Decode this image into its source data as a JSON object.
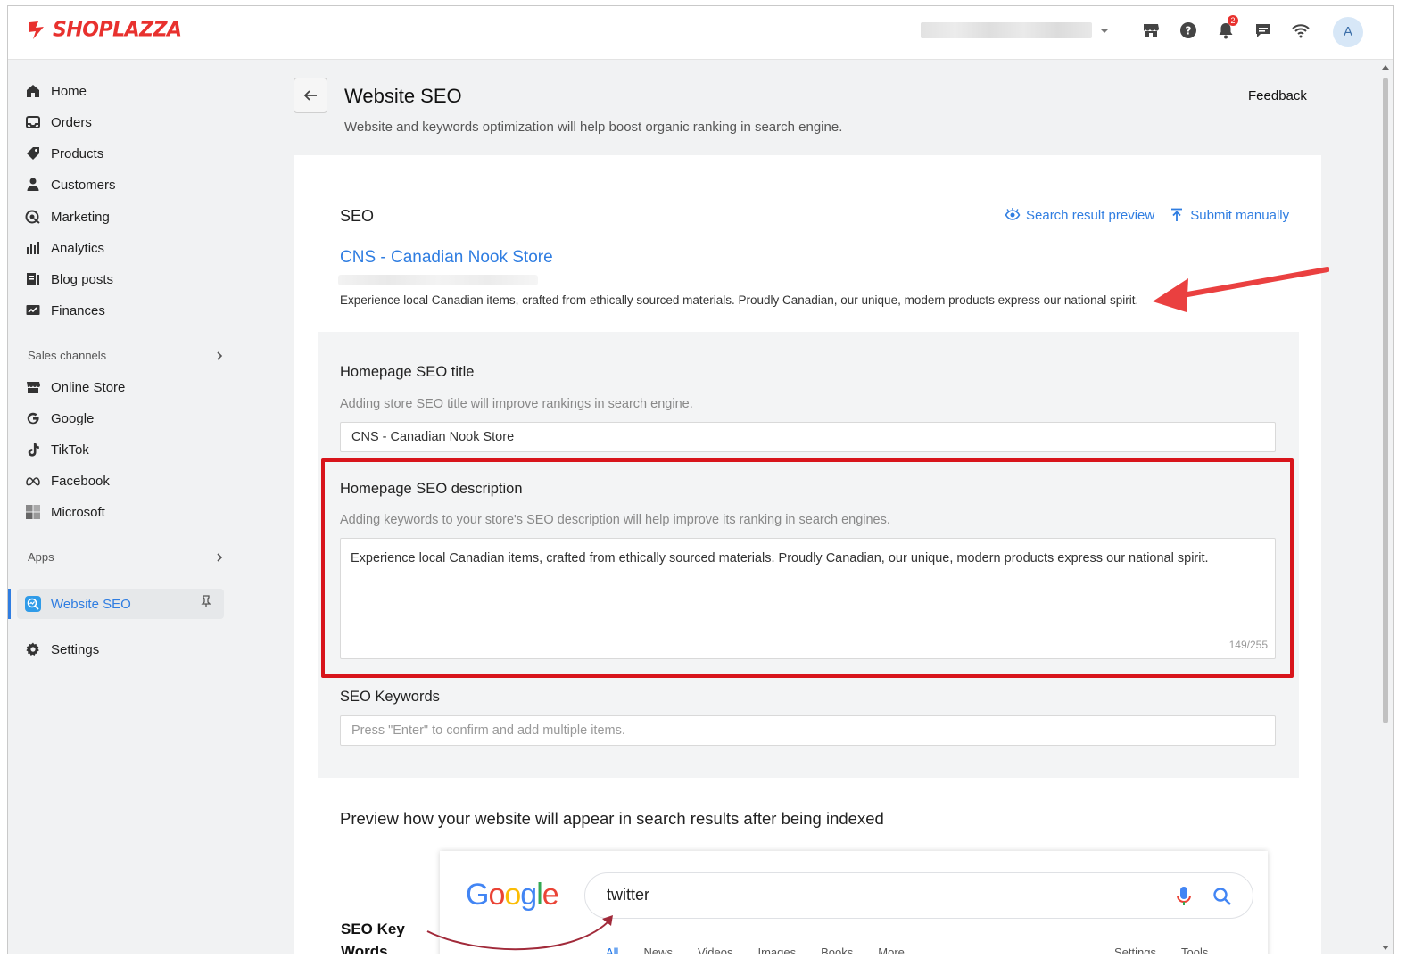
{
  "brand": {
    "name": "SHOPLAZZA",
    "color": "#e8312e"
  },
  "topbar": {
    "icons": [
      "storefront-icon",
      "help-icon",
      "bell-icon",
      "chat-icon",
      "wifi-icon"
    ],
    "notification_count": "2",
    "avatar_initial": "A"
  },
  "sidebar": {
    "items": [
      {
        "label": "Home",
        "icon": "home-icon"
      },
      {
        "label": "Orders",
        "icon": "orders-icon"
      },
      {
        "label": "Products",
        "icon": "tag-icon"
      },
      {
        "label": "Customers",
        "icon": "person-icon"
      },
      {
        "label": "Marketing",
        "icon": "target-icon"
      },
      {
        "label": "Analytics",
        "icon": "bar-chart-icon"
      },
      {
        "label": "Blog posts",
        "icon": "blog-icon"
      },
      {
        "label": "Finances",
        "icon": "finance-icon"
      }
    ],
    "sales_channels_header": "Sales channels",
    "channels": [
      {
        "label": "Online Store",
        "icon": "store-icon"
      },
      {
        "label": "Google",
        "icon": "google-icon"
      },
      {
        "label": "TikTok",
        "icon": "tiktok-icon"
      },
      {
        "label": "Facebook",
        "icon": "meta-icon"
      },
      {
        "label": "Microsoft",
        "icon": "microsoft-icon"
      }
    ],
    "apps_header": "Apps",
    "active_app": {
      "label": "Website SEO",
      "icon": "seo-app-icon"
    },
    "settings": {
      "label": "Settings",
      "icon": "gear-icon"
    }
  },
  "page": {
    "title": "Website SEO",
    "subtitle": "Website and keywords optimization will help boost organic ranking in search engine.",
    "feedback": "Feedback"
  },
  "seo_card": {
    "section_label": "SEO",
    "search_preview_link": "Search result preview",
    "submit_link": "Submit manually",
    "serp_title": "CNS - Canadian Nook Store",
    "serp_description": "Experience local Canadian items, crafted from ethically sourced materials. Proudly Canadian, our unique, modern products express our national spirit."
  },
  "form": {
    "title_label": "Homepage SEO title",
    "title_help": "Adding store SEO title will improve rankings in search engine.",
    "title_value": "CNS - Canadian Nook Store",
    "desc_label": "Homepage SEO description",
    "desc_help": "Adding keywords to your store's SEO description will help improve its ranking in search engines.",
    "desc_value": "Experience local Canadian items, crafted from ethically sourced materials. Proudly Canadian, our unique, modern products express our national spirit.",
    "desc_counter": "149/255",
    "keywords_label": "SEO Keywords",
    "keywords_placeholder": "Press \"Enter\" to confirm and add multiple items."
  },
  "preview": {
    "heading": "Preview how your website will appear in search results after being indexed",
    "google_query": "twitter",
    "google_tabs": [
      "All",
      "News",
      "Videos",
      "Images",
      "Books",
      "More"
    ],
    "google_tools": [
      "Settings",
      "Tools"
    ],
    "annotation": "SEO Key Words"
  },
  "colors": {
    "link": "#2f7de1",
    "highlight": "#d8141b",
    "arrow": "#ea4040"
  }
}
